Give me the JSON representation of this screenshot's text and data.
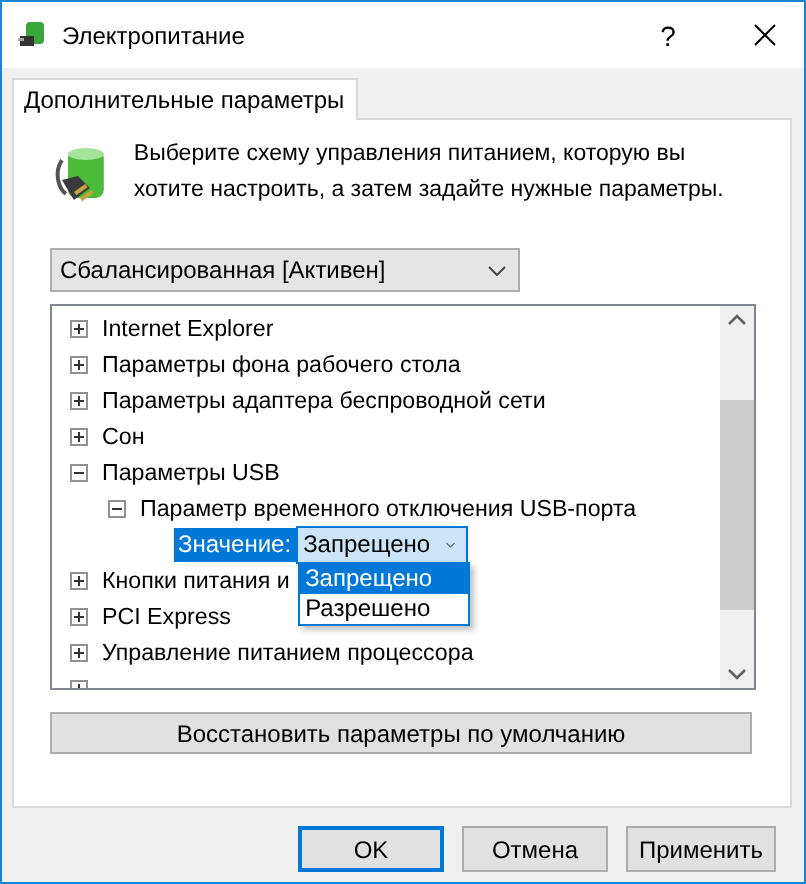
{
  "window": {
    "title": "Электропитание",
    "help": "?"
  },
  "tabs": [
    {
      "label": "Дополнительные параметры",
      "selected": true
    }
  ],
  "intro": "Выберите схему управления питанием, которую вы хотите настроить, а затем задайте нужные параметры.",
  "plan": {
    "value": "Сбалансированная [Активен]"
  },
  "tree": [
    {
      "label": "Internet Explorer",
      "expanded": false
    },
    {
      "label": "Параметры фона рабочего стола",
      "expanded": false
    },
    {
      "label": "Параметры адаптера беспроводной сети",
      "expanded": false
    },
    {
      "label": "Сон",
      "expanded": false
    },
    {
      "label": "Параметры USB",
      "expanded": true,
      "children": [
        {
          "label": "Параметр временного отключения USB-порта",
          "expanded": true,
          "setting": {
            "label": "Значение:",
            "value": "Запрещено",
            "selected": true,
            "options": [
              {
                "label": "Запрещено",
                "selected": true
              },
              {
                "label": "Разрешено",
                "selected": false
              }
            ]
          }
        }
      ]
    },
    {
      "label": "Кнопки питания и",
      "expanded": false
    },
    {
      "label": "PCI Express",
      "expanded": false
    },
    {
      "label": "Управление питанием процессора",
      "expanded": false
    },
    {
      "expanded": false
    }
  ],
  "restore_button": "Восстановить параметры по умолчанию",
  "buttons": [
    {
      "label": "OK",
      "default": true
    },
    {
      "label": "Отмена",
      "default": false
    },
    {
      "label": "Применить",
      "default": false
    }
  ]
}
